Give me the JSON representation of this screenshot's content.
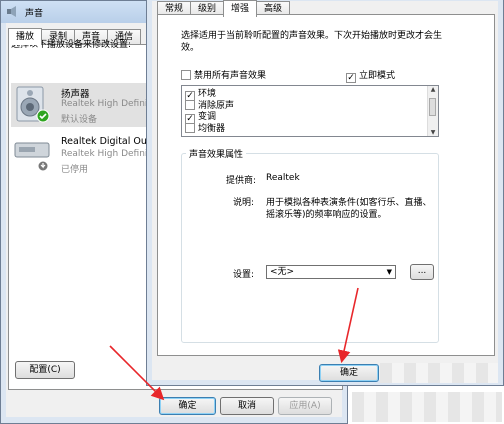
{
  "back": {
    "title": "声音",
    "tabs": [
      "播放",
      "录制",
      "声音",
      "通信"
    ],
    "instruction": "选择以下播放设备来修改设置:",
    "devices": [
      {
        "name": "扬声器",
        "driver": "Realtek High Definiti",
        "status": "默认设备"
      },
      {
        "name": "Realtek Digital Outp",
        "driver": "Realtek High Definiti",
        "status": "已停用"
      }
    ],
    "configure_label": "配置(C)",
    "ok_label": "确定",
    "cancel_label": "取消",
    "apply_label": "应用(A)"
  },
  "front": {
    "tabs": [
      "常规",
      "级别",
      "增强",
      "高级"
    ],
    "description": [
      "选择适用于当前聆听配置的声音效果。下次开始播放时更改才会生",
      "效。"
    ],
    "disable_all_label": "禁用所有声音效果",
    "immediate_mode_label": "立即模式",
    "effects": [
      {
        "label": "环境",
        "checked": true
      },
      {
        "label": "消除原声",
        "checked": false
      },
      {
        "label": "变调",
        "checked": true
      },
      {
        "label": "均衡器",
        "checked": false
      }
    ],
    "group_title": "声音效果属性",
    "provider_label": "提供商:",
    "provider_value": "Realtek",
    "explain_label": "说明:",
    "explain_value": [
      "用于模拟各种表演条件(如客行乐、直播、",
      "摇滚乐等)的频率响应的设置。"
    ],
    "settings_label": "设置:",
    "settings_value": "<无>",
    "browse_label": "...",
    "ok_label": "确定"
  },
  "colors": {
    "arrow": "#e8262a",
    "check_green": "#2fa520"
  }
}
